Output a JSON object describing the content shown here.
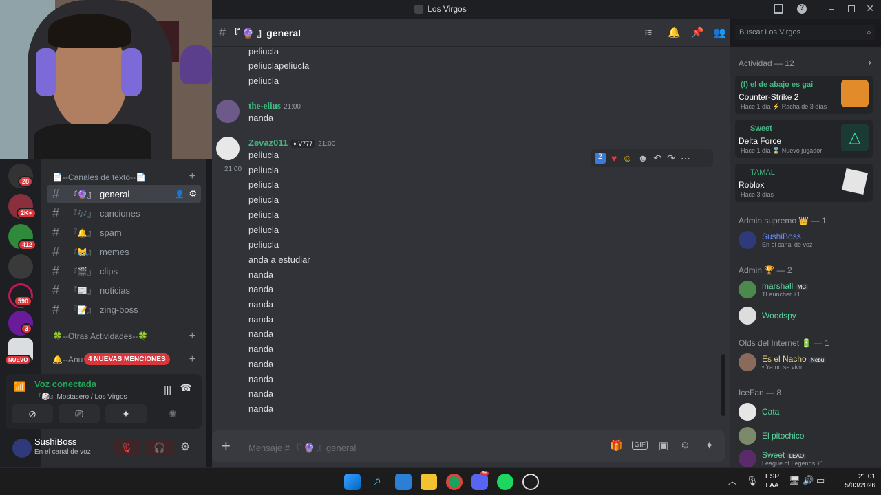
{
  "window": {
    "title": "Los Virgos"
  },
  "header": {
    "channel": "『 🔮 』general",
    "search_placeholder": "Buscar Los Virgos"
  },
  "colors": {
    "accent": "#5865f2",
    "green": "#23a55a",
    "mention": "#da373c"
  },
  "rail": {
    "badges": [
      "28",
      "2K+",
      "412",
      "590",
      "3"
    ],
    "new_label": "NUEVO",
    "mentions_label": "4 NUEVAS MENCIONES"
  },
  "channels": {
    "category_text": "📄--Canales de texto--📄",
    "items": [
      "general",
      "canciones",
      "spam",
      "memes",
      "clips",
      "noticias",
      "zing-boss"
    ],
    "category_other": "🍀--Otras Actividades--🍀",
    "category_anu": "🔔--Anu"
  },
  "voice": {
    "status": "Voz conectada",
    "location": "『🎲』Mostasero / Los Virgos"
  },
  "user": {
    "name": "SushiBoss",
    "status": "En el canal de voz"
  },
  "messages": {
    "prev": [
      "peliucla",
      "peliuclapeliucla",
      "peliucla"
    ],
    "elius": {
      "name": "the-elius",
      "time": "21:00",
      "text": "nanda"
    },
    "zevaz": {
      "name": "Zevaz011",
      "tag": "V777",
      "time": "21:00",
      "side_time": "21:00",
      "lines": [
        "peliucla",
        "peliucla",
        "peliucla",
        "peliucla",
        "peliucla",
        "peliucla",
        "peliucla",
        "anda a estudiar",
        "nanda",
        "nanda",
        "nanda",
        "nanda",
        "nanda",
        "nanda",
        "nanda",
        "nanda",
        "nanda",
        "nanda"
      ]
    },
    "reaction_count": "2"
  },
  "composer": {
    "placeholder": "Mensaje # 『 🔮 』general"
  },
  "members": {
    "activity_header": "Actividad — 12",
    "activities": [
      {
        "user": "(f) el de abajo es gai",
        "game": "Counter-Strike 2",
        "meta": "Hace 1 día  ⚡ Racha de 3 días"
      },
      {
        "user": "Sweet",
        "game": "Delta Force",
        "meta": "Hace 1 día  ⌛ Nuevo jugador"
      },
      {
        "user": "TAMAL",
        "game": "Roblox",
        "meta": "Hace 3 días"
      }
    ],
    "groups": [
      {
        "title": "Admin supremo 👑 — 1"
      },
      {
        "title": "Admin 🏆 — 2"
      },
      {
        "title": "Olds del Internet 🔋 — 1"
      },
      {
        "title": "IceFan — 8"
      }
    ],
    "list": [
      {
        "name": "SushiBoss",
        "status": "En el canal de voz",
        "color": "#6b8cf7"
      },
      {
        "name": "marshall",
        "tag": "MC",
        "status": "TLauncher +1",
        "color": "#5cd6a0"
      },
      {
        "name": "Woodspy",
        "status": "",
        "color": "#5cd6a0"
      },
      {
        "name": "Es el Nacho",
        "tag": "Nebu",
        "status": "• Ya no se vivir",
        "color": "#e7d889"
      },
      {
        "name": "Cata",
        "status": "",
        "color": "#5cd6a0"
      },
      {
        "name": "El pitochico",
        "status": "",
        "color": "#5cd6a0"
      },
      {
        "name": "Sweet",
        "tag": "LEAO",
        "status": "League of Legends +1",
        "color": "#5cd6a0"
      }
    ]
  },
  "taskbar": {
    "lang": "ESP",
    "lang2": "LAA",
    "time": "21:01",
    "date": "5/03/2026",
    "discord_badge": "9+"
  }
}
